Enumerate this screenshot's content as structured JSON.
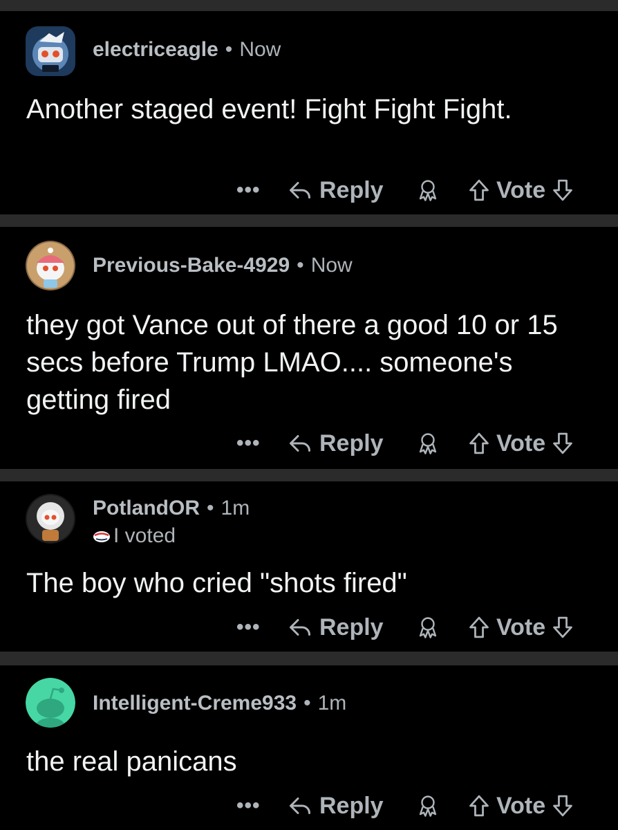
{
  "comments": [
    {
      "username": "electriceagle",
      "time": "Now",
      "flair": "",
      "text": "Another staged event! Fight Fight Fight.",
      "avatar": "robot-avatar-icon"
    },
    {
      "username": "Previous-Bake-4929",
      "time": "Now",
      "flair": "",
      "text": "they got Vance out of there a good 10 or 15 secs before Trump LMAO.... someone's getting fired",
      "avatar": "snoo-beanie-avatar-icon"
    },
    {
      "username": "PotlandOR",
      "time": "1m",
      "flair": "I voted",
      "text": "The boy who cried \"shots fired\"",
      "avatar": "astronaut-avatar-icon"
    },
    {
      "username": "Intelligent-Creme933",
      "time": "1m",
      "flair": "",
      "text": "the real panicans",
      "avatar": "default-snoo-avatar-icon"
    }
  ],
  "actions": {
    "more": "•••",
    "reply": "Reply",
    "vote": "Vote"
  },
  "colors": {
    "background": "#000000",
    "divider": "#2b2b2b",
    "muted_text": "#aeb4b9",
    "body_text": "#f1f3f4",
    "default_avatar": "#46d7a5"
  }
}
